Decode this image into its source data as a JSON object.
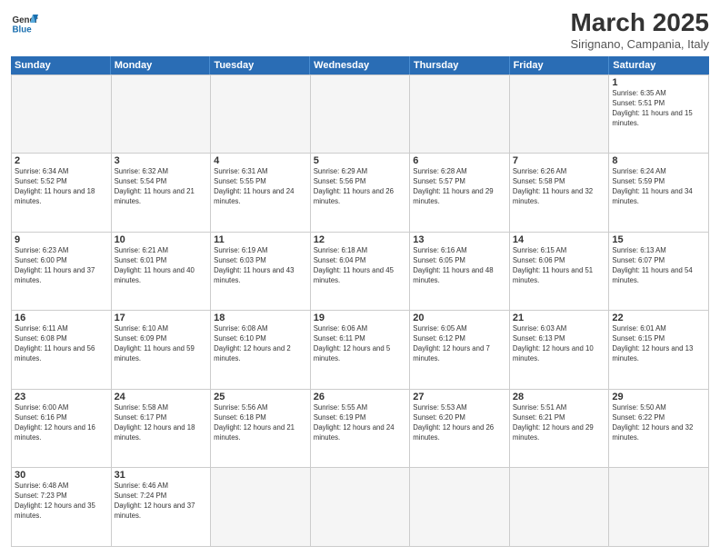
{
  "header": {
    "logo_general": "General",
    "logo_blue": "Blue",
    "month_title": "March 2025",
    "subtitle": "Sirignano, Campania, Italy"
  },
  "weekdays": [
    "Sunday",
    "Monday",
    "Tuesday",
    "Wednesday",
    "Thursday",
    "Friday",
    "Saturday"
  ],
  "cells": [
    {
      "day": "",
      "empty": true
    },
    {
      "day": "",
      "empty": true
    },
    {
      "day": "",
      "empty": true
    },
    {
      "day": "",
      "empty": true
    },
    {
      "day": "",
      "empty": true
    },
    {
      "day": "",
      "empty": true
    },
    {
      "day": "1",
      "sunrise": "Sunrise: 6:35 AM",
      "sunset": "Sunset: 5:51 PM",
      "daylight": "Daylight: 11 hours and 15 minutes."
    },
    {
      "day": "2",
      "sunrise": "Sunrise: 6:34 AM",
      "sunset": "Sunset: 5:52 PM",
      "daylight": "Daylight: 11 hours and 18 minutes."
    },
    {
      "day": "3",
      "sunrise": "Sunrise: 6:32 AM",
      "sunset": "Sunset: 5:54 PM",
      "daylight": "Daylight: 11 hours and 21 minutes."
    },
    {
      "day": "4",
      "sunrise": "Sunrise: 6:31 AM",
      "sunset": "Sunset: 5:55 PM",
      "daylight": "Daylight: 11 hours and 24 minutes."
    },
    {
      "day": "5",
      "sunrise": "Sunrise: 6:29 AM",
      "sunset": "Sunset: 5:56 PM",
      "daylight": "Daylight: 11 hours and 26 minutes."
    },
    {
      "day": "6",
      "sunrise": "Sunrise: 6:28 AM",
      "sunset": "Sunset: 5:57 PM",
      "daylight": "Daylight: 11 hours and 29 minutes."
    },
    {
      "day": "7",
      "sunrise": "Sunrise: 6:26 AM",
      "sunset": "Sunset: 5:58 PM",
      "daylight": "Daylight: 11 hours and 32 minutes."
    },
    {
      "day": "8",
      "sunrise": "Sunrise: 6:24 AM",
      "sunset": "Sunset: 5:59 PM",
      "daylight": "Daylight: 11 hours and 34 minutes."
    },
    {
      "day": "9",
      "sunrise": "Sunrise: 6:23 AM",
      "sunset": "Sunset: 6:00 PM",
      "daylight": "Daylight: 11 hours and 37 minutes."
    },
    {
      "day": "10",
      "sunrise": "Sunrise: 6:21 AM",
      "sunset": "Sunset: 6:01 PM",
      "daylight": "Daylight: 11 hours and 40 minutes."
    },
    {
      "day": "11",
      "sunrise": "Sunrise: 6:19 AM",
      "sunset": "Sunset: 6:03 PM",
      "daylight": "Daylight: 11 hours and 43 minutes."
    },
    {
      "day": "12",
      "sunrise": "Sunrise: 6:18 AM",
      "sunset": "Sunset: 6:04 PM",
      "daylight": "Daylight: 11 hours and 45 minutes."
    },
    {
      "day": "13",
      "sunrise": "Sunrise: 6:16 AM",
      "sunset": "Sunset: 6:05 PM",
      "daylight": "Daylight: 11 hours and 48 minutes."
    },
    {
      "day": "14",
      "sunrise": "Sunrise: 6:15 AM",
      "sunset": "Sunset: 6:06 PM",
      "daylight": "Daylight: 11 hours and 51 minutes."
    },
    {
      "day": "15",
      "sunrise": "Sunrise: 6:13 AM",
      "sunset": "Sunset: 6:07 PM",
      "daylight": "Daylight: 11 hours and 54 minutes."
    },
    {
      "day": "16",
      "sunrise": "Sunrise: 6:11 AM",
      "sunset": "Sunset: 6:08 PM",
      "daylight": "Daylight: 11 hours and 56 minutes."
    },
    {
      "day": "17",
      "sunrise": "Sunrise: 6:10 AM",
      "sunset": "Sunset: 6:09 PM",
      "daylight": "Daylight: 11 hours and 59 minutes."
    },
    {
      "day": "18",
      "sunrise": "Sunrise: 6:08 AM",
      "sunset": "Sunset: 6:10 PM",
      "daylight": "Daylight: 12 hours and 2 minutes."
    },
    {
      "day": "19",
      "sunrise": "Sunrise: 6:06 AM",
      "sunset": "Sunset: 6:11 PM",
      "daylight": "Daylight: 12 hours and 5 minutes."
    },
    {
      "day": "20",
      "sunrise": "Sunrise: 6:05 AM",
      "sunset": "Sunset: 6:12 PM",
      "daylight": "Daylight: 12 hours and 7 minutes."
    },
    {
      "day": "21",
      "sunrise": "Sunrise: 6:03 AM",
      "sunset": "Sunset: 6:13 PM",
      "daylight": "Daylight: 12 hours and 10 minutes."
    },
    {
      "day": "22",
      "sunrise": "Sunrise: 6:01 AM",
      "sunset": "Sunset: 6:15 PM",
      "daylight": "Daylight: 12 hours and 13 minutes."
    },
    {
      "day": "23",
      "sunrise": "Sunrise: 6:00 AM",
      "sunset": "Sunset: 6:16 PM",
      "daylight": "Daylight: 12 hours and 16 minutes."
    },
    {
      "day": "24",
      "sunrise": "Sunrise: 5:58 AM",
      "sunset": "Sunset: 6:17 PM",
      "daylight": "Daylight: 12 hours and 18 minutes."
    },
    {
      "day": "25",
      "sunrise": "Sunrise: 5:56 AM",
      "sunset": "Sunset: 6:18 PM",
      "daylight": "Daylight: 12 hours and 21 minutes."
    },
    {
      "day": "26",
      "sunrise": "Sunrise: 5:55 AM",
      "sunset": "Sunset: 6:19 PM",
      "daylight": "Daylight: 12 hours and 24 minutes."
    },
    {
      "day": "27",
      "sunrise": "Sunrise: 5:53 AM",
      "sunset": "Sunset: 6:20 PM",
      "daylight": "Daylight: 12 hours and 26 minutes."
    },
    {
      "day": "28",
      "sunrise": "Sunrise: 5:51 AM",
      "sunset": "Sunset: 6:21 PM",
      "daylight": "Daylight: 12 hours and 29 minutes."
    },
    {
      "day": "29",
      "sunrise": "Sunrise: 5:50 AM",
      "sunset": "Sunset: 6:22 PM",
      "daylight": "Daylight: 12 hours and 32 minutes."
    },
    {
      "day": "30",
      "sunrise": "Sunrise: 6:48 AM",
      "sunset": "Sunset: 7:23 PM",
      "daylight": "Daylight: 12 hours and 35 minutes."
    },
    {
      "day": "31",
      "sunrise": "Sunrise: 6:46 AM",
      "sunset": "Sunset: 7:24 PM",
      "daylight": "Daylight: 12 hours and 37 minutes."
    },
    {
      "day": "",
      "empty": true
    },
    {
      "day": "",
      "empty": true
    },
    {
      "day": "",
      "empty": true
    },
    {
      "day": "",
      "empty": true
    },
    {
      "day": "",
      "empty": true
    }
  ]
}
